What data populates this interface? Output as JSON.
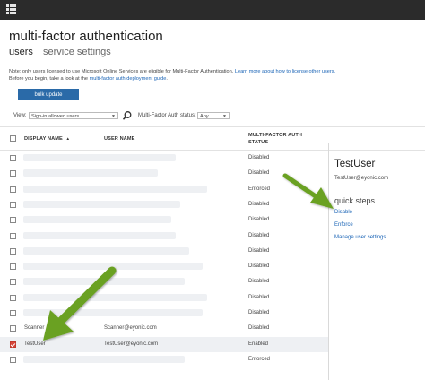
{
  "page": {
    "title": "multi-factor authentication",
    "tabs": [
      {
        "label": "users",
        "active": true
      },
      {
        "label": "service settings",
        "active": false
      }
    ]
  },
  "note": {
    "line1_prefix": "Note: only users licensed to use Microsoft Online Services are eligible for Multi-Factor Authentication. ",
    "line1_link": "Learn more about how to license other users.",
    "line2_prefix": "Before you begin, take a look at the ",
    "line2_link": "multi-factor auth deployment guide",
    "line2_suffix": "."
  },
  "toolbar": {
    "bulk_update_label": "bulk update",
    "view_label": "View:",
    "view_value": "Sign-in allowed users",
    "mfa_status_label": "Multi-Factor Auth status:",
    "mfa_status_value": "Any"
  },
  "table": {
    "headers": {
      "display_name": "DISPLAY NAME",
      "sort_indicator": "▲",
      "user_name": "USER NAME",
      "mfa_status_line1": "MULTI-FACTOR AUTH",
      "mfa_status_line2": "STATUS"
    },
    "rows": [
      {
        "display_name": "",
        "user_name": "",
        "status": "Disabled",
        "checked": false
      },
      {
        "display_name": "",
        "user_name": "",
        "status": "Disabled",
        "checked": false
      },
      {
        "display_name": "",
        "user_name": "",
        "status": "Enforced",
        "checked": false
      },
      {
        "display_name": "",
        "user_name": "",
        "status": "Disabled",
        "checked": false
      },
      {
        "display_name": "",
        "user_name": "",
        "status": "Disabled",
        "checked": false
      },
      {
        "display_name": "",
        "user_name": "",
        "status": "Disabled",
        "checked": false
      },
      {
        "display_name": "",
        "user_name": "",
        "status": "Disabled",
        "checked": false
      },
      {
        "display_name": "",
        "user_name": "",
        "status": "Disabled",
        "checked": false
      },
      {
        "display_name": "",
        "user_name": "",
        "status": "Disabled",
        "checked": false
      },
      {
        "display_name": "",
        "user_name": "",
        "status": "Disabled",
        "checked": false
      },
      {
        "display_name": "",
        "user_name": "",
        "status": "Disabled",
        "checked": false
      },
      {
        "display_name": "Scanner",
        "user_name": "Scanner@eyonic.com",
        "status": "Disabled",
        "checked": false
      },
      {
        "display_name": "TestUser",
        "user_name": "TestUser@eyonic.com",
        "status": "Enabled",
        "checked": true
      },
      {
        "display_name": "",
        "user_name": "",
        "status": "Enforced",
        "checked": false
      }
    ]
  },
  "panel": {
    "user_name": "TestUser",
    "email": "TestUser@eyonic.com",
    "quick_steps_title": "quick steps",
    "actions": [
      "Disable",
      "Enforce",
      "Manage user settings"
    ]
  },
  "colors": {
    "topbar": "#2b2b2b",
    "accent_button": "#2a6aa8",
    "link": "#1a64b6",
    "checkbox_checked": "#d9463b",
    "annotation_arrow": "#6aa121"
  },
  "icons": [
    "app-launcher-icon",
    "search-icon",
    "chevron-down-icon",
    "sort-ascending-icon",
    "checkmark-icon",
    "arrow-annotation-icon"
  ]
}
